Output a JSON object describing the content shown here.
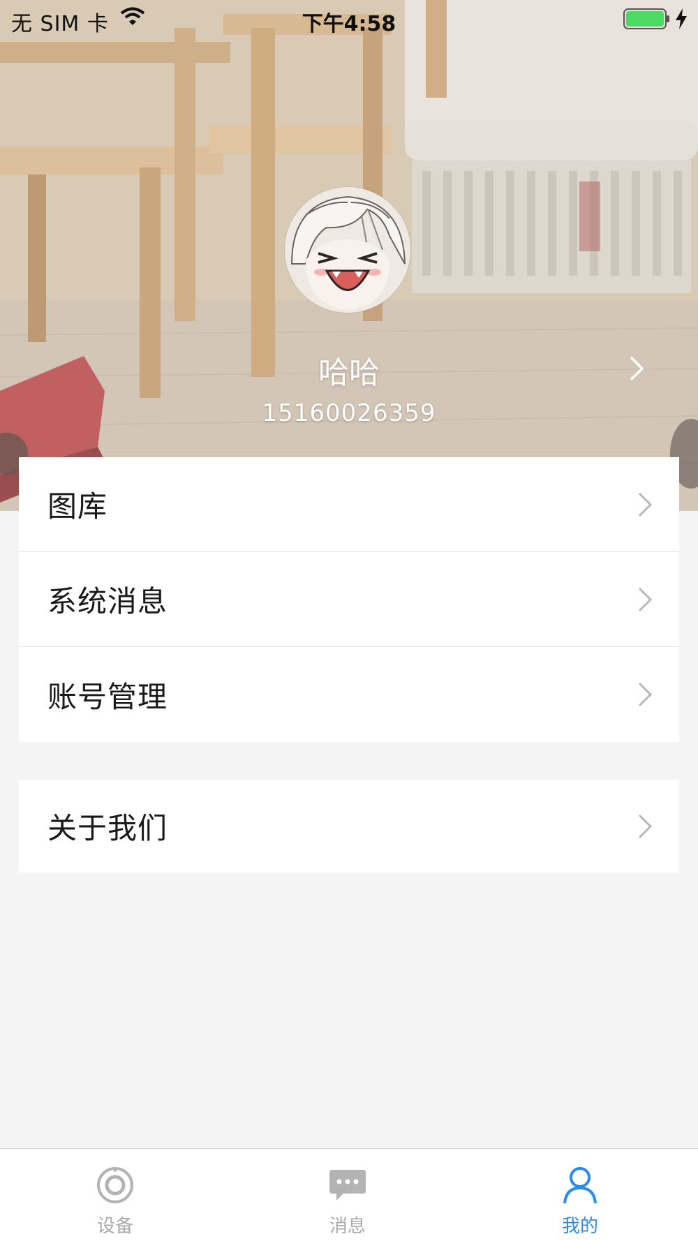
{
  "status_bar": {
    "carrier": "无 SIM 卡",
    "time": "下午4:58",
    "battery_color": "#4cd964"
  },
  "profile": {
    "name": "哈哈",
    "phone": "15160026359"
  },
  "menu": {
    "group1": [
      {
        "label": "图库"
      },
      {
        "label": "系统消息"
      },
      {
        "label": "账号管理"
      }
    ],
    "group2": [
      {
        "label": "关于我们"
      }
    ]
  },
  "tab_bar": {
    "tabs": [
      {
        "label": "设备",
        "icon": "device-icon",
        "active": false
      },
      {
        "label": "消息",
        "icon": "message-icon",
        "active": false
      },
      {
        "label": "我的",
        "icon": "person-icon",
        "active": true
      }
    ],
    "active_color": "#2b8de8",
    "inactive_color": "#a9a9a9"
  }
}
